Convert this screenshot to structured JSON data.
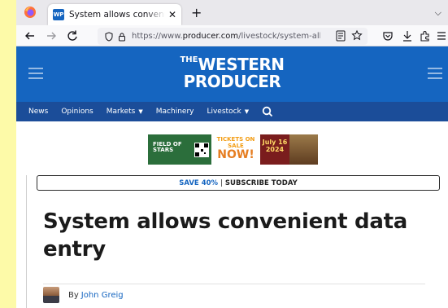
{
  "browser": {
    "tab_title": "System allows convenient data entry",
    "favicon_text": "WP",
    "url_prefix": "https://www.",
    "url_host": "producer.com",
    "url_path": "/livestock/system-allows-"
  },
  "site": {
    "logo_the": "THE",
    "logo_line1": "WESTERN",
    "logo_line2": "PRODUCER",
    "nav": [
      {
        "label": "News"
      },
      {
        "label": "Opinions"
      },
      {
        "label": "Markets"
      },
      {
        "label": "Machinery"
      },
      {
        "label": "Livestock"
      }
    ],
    "brand_color": "#1565c0",
    "nav_color": "#1b4d99"
  },
  "ad": {
    "field_of_stars": "FIELD OF STARS",
    "tickets_on": "TICKETS ON",
    "sale": "SALE",
    "now": "NOW!",
    "date": "July 16",
    "year": "2024"
  },
  "subscribe": {
    "save": "SAVE 40%",
    "separator": "|",
    "cta": "SUBSCRIBE TODAY"
  },
  "article": {
    "headline": "System allows convenient data entry",
    "by": "By",
    "author": "John Greig"
  },
  "icons": {
    "back": "arrow-left-icon",
    "forward": "arrow-right-icon",
    "reload": "reload-icon",
    "shield": "shield-icon",
    "lock": "lock-icon",
    "reader": "reader-view-icon",
    "bookmark": "star-icon",
    "pocket": "pocket-icon",
    "download": "download-icon",
    "extensions": "extensions-icon",
    "menu": "hamburger-icon"
  }
}
